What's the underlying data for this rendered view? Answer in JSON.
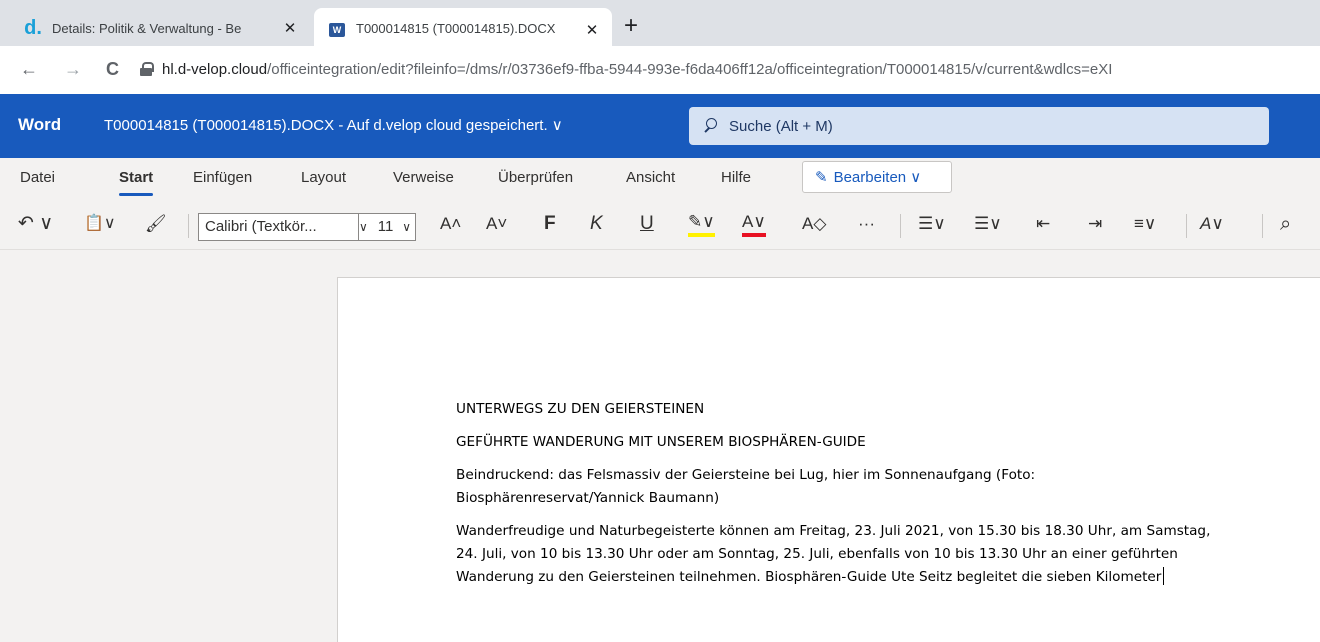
{
  "browser": {
    "tabs": [
      {
        "title": "Details: Politik & Verwaltung - Be",
        "icon": "d-velop-icon",
        "close": "✕"
      },
      {
        "title": "T000014815 (T000014815).DOCX",
        "icon": "word-icon",
        "close": "✕"
      }
    ],
    "new_tab": "+",
    "nav": {
      "back": "←",
      "forward": "→",
      "reload": "C"
    },
    "url": {
      "host": "hl.d-velop.cloud",
      "path": "/officeintegration/edit?fileinfo=/dms/r/03736ef9-ffba-5944-993e-f6da406ff12a/officeintegration/T000014815/v/current&wdlcs=eXI"
    }
  },
  "word": {
    "app_name": "Word",
    "doc_title": "T000014815 (T000014815).DOCX  -  Auf d.velop cloud gespeichert. ∨",
    "search_placeholder": "Suche (Alt + M)",
    "brand_color": "#185abd"
  },
  "ribbon": {
    "tabs": [
      "Datei",
      "Start",
      "Einfügen",
      "Layout",
      "Verweise",
      "Überprüfen",
      "Ansicht",
      "Hilfe"
    ],
    "active_tab": "Start",
    "edit_button": "Bearbeiten ∨",
    "font_name": "Calibri (Textkör...",
    "font_size": "11",
    "tools": {
      "undo": "↶ ∨",
      "paste": "📋∨",
      "format_painter": "🖌",
      "grow_font": "A˄",
      "shrink_font": "A˅",
      "bold": "F",
      "italic": "K",
      "underline": "U",
      "highlight": "✎∨",
      "font_color": "A∨",
      "clear_format": "A◇",
      "more": "···",
      "bullets": "☰∨",
      "numbering": "☰∨",
      "outdent": "⇤",
      "indent": "⇥",
      "align": "≡∨",
      "styles": "A∨",
      "find": "⌕"
    }
  },
  "document": {
    "paragraphs": [
      "UNTERWEGS ZU DEN GEIERSTEINEN",
      "GEFÜHRTE WANDERUNG MIT UNSEREM BIOSPHÄREN-GUIDE",
      "Beindruckend: das Felsmassiv der Geiersteine bei Lug, hier im Sonnenaufgang (Foto: Biosphärenreservat/Yannick Baumann)",
      "Wanderfreudige und Naturbegeisterte können am Freitag, 23. Juli 2021, von 15.30 bis 18.30 Uhr, am Samstag, 24. Juli, von 10 bis 13.30 Uhr oder am Sonntag, 25. Juli, ebenfalls von 10 bis 13.30 Uhr an einer geführten Wanderung zu den Geiersteinen teilnehmen. Biosphären-Guide Ute Seitz begleitet die sieben Kilometer"
    ]
  }
}
